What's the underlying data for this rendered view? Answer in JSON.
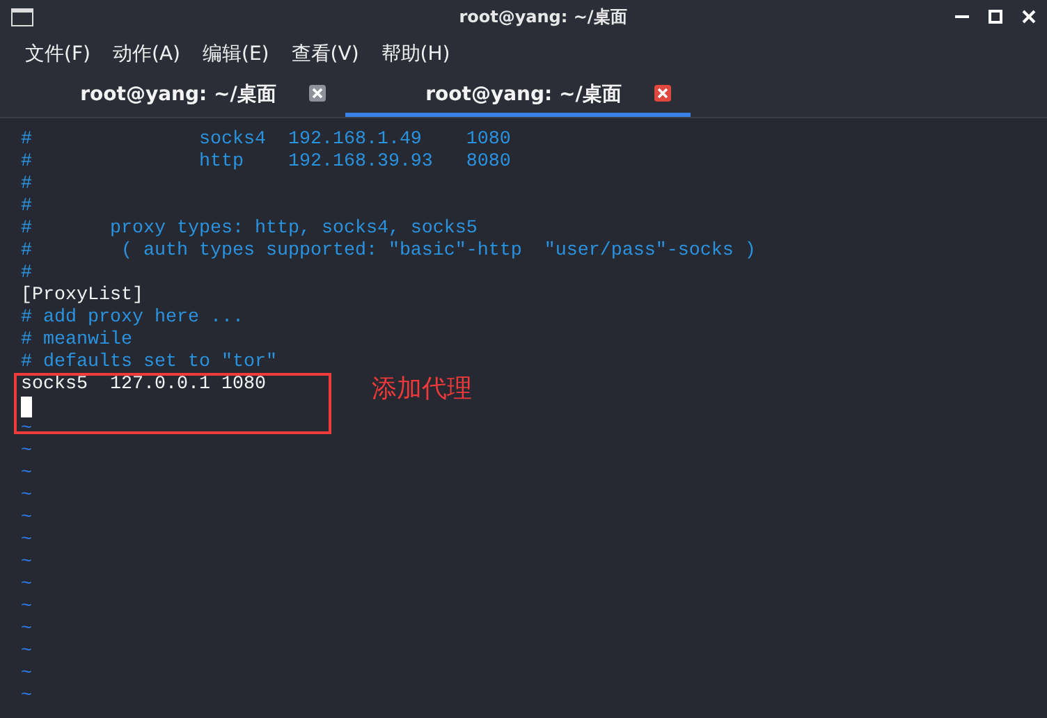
{
  "window": {
    "title": "root@yang: ~/桌面"
  },
  "menu": [
    "文件(F)",
    "动作(A)",
    "编辑(E)",
    "查看(V)",
    "帮助(H)"
  ],
  "tabs": [
    {
      "label": "root@yang: ~/桌面",
      "selected": false
    },
    {
      "label": "root@yang: ~/桌面",
      "selected": true
    }
  ],
  "terminal": {
    "lines": [
      {
        "kind": "comment",
        "text": "#               socks4  192.168.1.49    1080"
      },
      {
        "kind": "comment",
        "text": "#               http    192.168.39.93   8080"
      },
      {
        "kind": "comment",
        "text": "#"
      },
      {
        "kind": "comment",
        "text": "#"
      },
      {
        "kind": "comment",
        "text": "#       proxy types: http, socks4, socks5"
      },
      {
        "kind": "comment",
        "text": "#        ( auth types supported: \"basic\"-http  \"user/pass\"-socks )"
      },
      {
        "kind": "comment",
        "text": "#"
      },
      {
        "kind": "plain",
        "text": "[ProxyList]"
      },
      {
        "kind": "comment",
        "text": "# add proxy here ..."
      },
      {
        "kind": "comment",
        "text": "# meanwile"
      },
      {
        "kind": "comment",
        "text": "# defaults set to \"tor\""
      },
      {
        "kind": "plain",
        "text": "socks5  127.0.0.1 1080"
      },
      {
        "kind": "cursor"
      },
      {
        "kind": "tilde",
        "text": "~"
      },
      {
        "kind": "tilde",
        "text": "~"
      },
      {
        "kind": "tilde",
        "text": "~"
      },
      {
        "kind": "tilde",
        "text": "~"
      },
      {
        "kind": "tilde",
        "text": "~"
      },
      {
        "kind": "tilde",
        "text": "~"
      },
      {
        "kind": "tilde",
        "text": "~"
      },
      {
        "kind": "tilde",
        "text": "~"
      },
      {
        "kind": "tilde",
        "text": "~"
      },
      {
        "kind": "tilde",
        "text": "~"
      },
      {
        "kind": "tilde",
        "text": "~"
      },
      {
        "kind": "tilde",
        "text": "~"
      },
      {
        "kind": "tilde",
        "text": "~"
      }
    ]
  },
  "annotation": {
    "label": "添加代理"
  }
}
